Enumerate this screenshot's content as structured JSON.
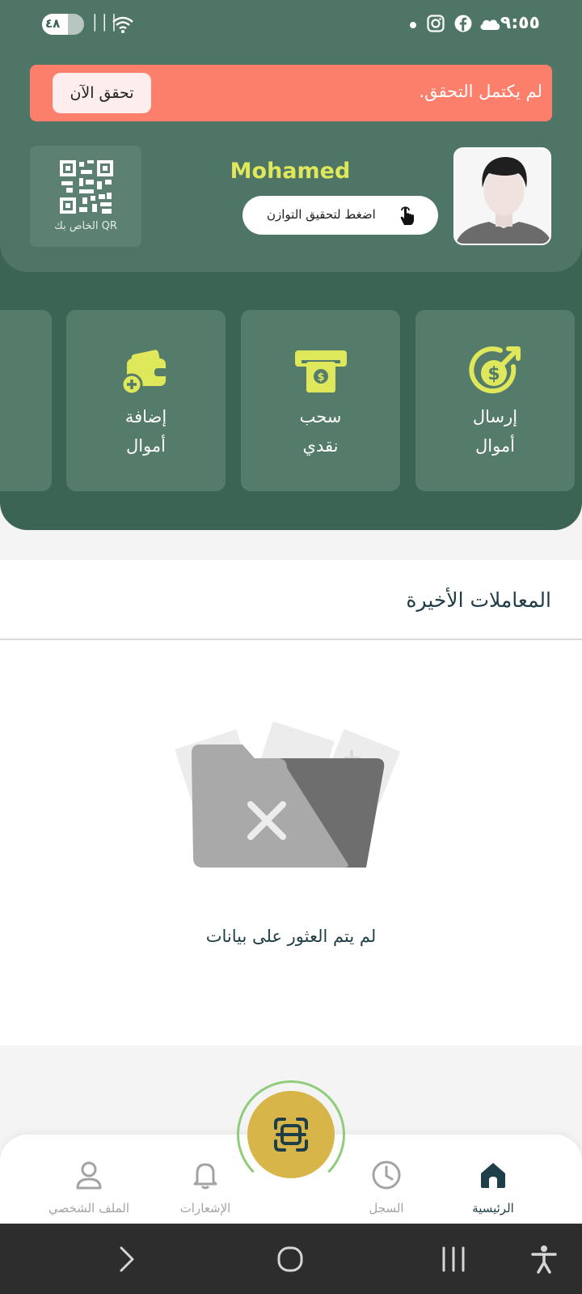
{
  "status_bar": {
    "time": "٩:٥٥",
    "battery": "٤٨"
  },
  "verify_banner": {
    "message": "لم يكتمل التحقق.",
    "button": "تحقق الآن"
  },
  "profile": {
    "name": "Mohamed",
    "balance_button": "اضغط لتحقيق التوازن",
    "qr_label": "QR الخاص بك"
  },
  "actions": [
    {
      "line1": "إرسال",
      "line2": "أموال",
      "icon": "send-money-icon"
    },
    {
      "line1": "سحب",
      "line2": "نقدي",
      "icon": "cash-withdraw-icon"
    },
    {
      "line1": "إضافة",
      "line2": "أموال",
      "icon": "add-money-icon"
    }
  ],
  "recent": {
    "title": "المعاملات الأخيرة",
    "empty_text": "لم يتم العثور على بيانات"
  },
  "bottom_nav": {
    "home": "الرئيسية",
    "history": "السجل",
    "notifications": "الإشعارات",
    "profile": "الملف الشخصي"
  },
  "colors": {
    "header": "#3c6454",
    "header_top": "#4e7565",
    "tile": "#557b6b",
    "accent_yellow": "#dfe75a",
    "banner": "#fb7f6b",
    "scan_button": "#d7b548",
    "active_nav": "#1e3f49"
  }
}
